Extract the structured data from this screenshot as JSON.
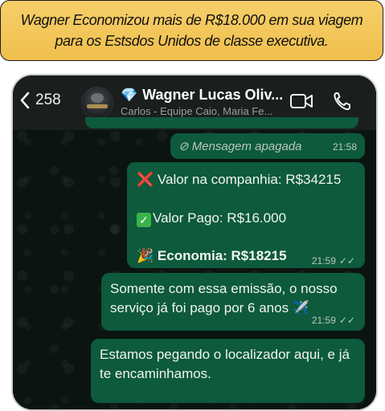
{
  "banner": {
    "line1": "Wagner Economizou mais de R$18.000 em sua viagem",
    "line2": "para os Estsdos Unidos de classe executiva."
  },
  "header": {
    "back_count": "258",
    "title": "Wagner Lucas Oliv...",
    "subtitle": "Carlos - Equipe Caio, Maria Fe...",
    "icons": [
      "chevron-left-icon",
      "avatar",
      "gem-icon",
      "video-icon",
      "phone-icon"
    ]
  },
  "messages": [
    {
      "type": "deleted",
      "text": "Mensagem apagada",
      "time": "21:58"
    },
    {
      "type": "text",
      "lines": [
        {
          "emoji": "❌",
          "text": "Valor na companhia: R$34215"
        },
        {
          "emoji": "✅",
          "text": "Valor Pago: R$16.000"
        },
        {
          "emoji": "🎉",
          "text": "Economia: R$18215"
        }
      ],
      "time": "21:59"
    },
    {
      "type": "text",
      "text": "Somente com essa emissão, o nosso serviço já foi pago por 6 anos ✈️",
      "time": "21:59"
    },
    {
      "type": "text",
      "text": "Estamos pegando o localizador aqui, e já te encaminhamos."
    }
  ],
  "colors": {
    "banner": "#f0bf4c",
    "bubble_out": "#0d5a3c",
    "header": "#1a1f1d",
    "chat_bg": "#0b1411"
  }
}
